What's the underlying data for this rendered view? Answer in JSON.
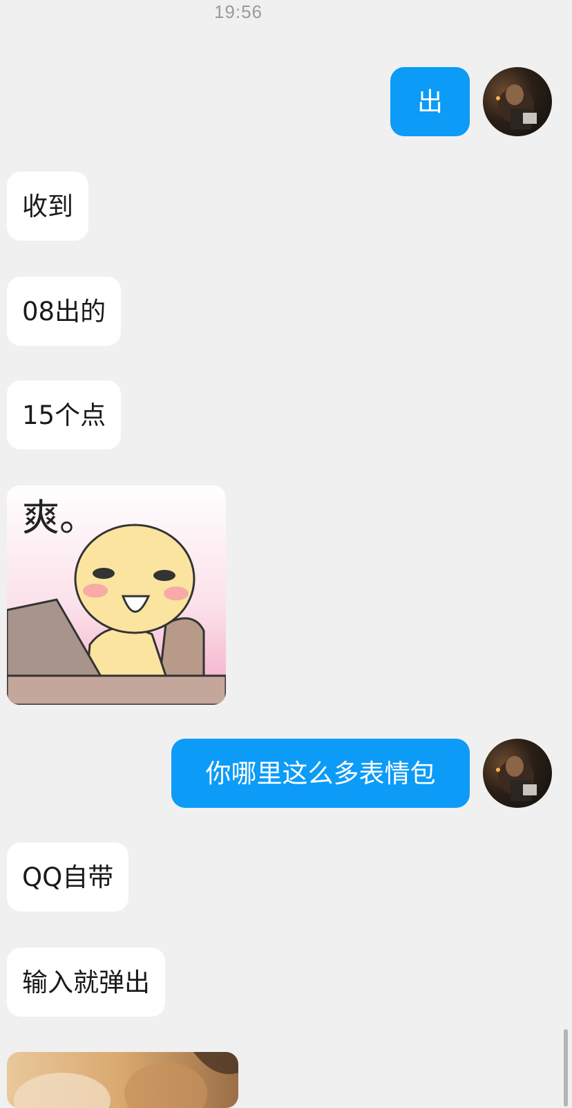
{
  "chat": {
    "timestamp": "19:56",
    "messages": [
      {
        "direction": "out",
        "text": "出"
      },
      {
        "direction": "in",
        "text": "收到"
      },
      {
        "direction": "in",
        "text": "08出的"
      },
      {
        "direction": "in",
        "text": "15个点"
      },
      {
        "direction": "in",
        "type": "sticker",
        "caption": "爽。"
      },
      {
        "direction": "out",
        "text": "你哪里这么多表情包"
      },
      {
        "direction": "in",
        "text": "QQ自带"
      },
      {
        "direction": "in",
        "text": "输入就弹出"
      },
      {
        "direction": "in",
        "type": "image"
      }
    ]
  },
  "colors": {
    "background": "#f0f0f0",
    "incoming_bubble": "#ffffff",
    "outgoing_bubble": "#0c9bf7",
    "timestamp_text": "#9a9a9a"
  },
  "icons": {
    "avatar": "user-avatar-photo",
    "scrollbar": "scrollbar-thumb"
  }
}
